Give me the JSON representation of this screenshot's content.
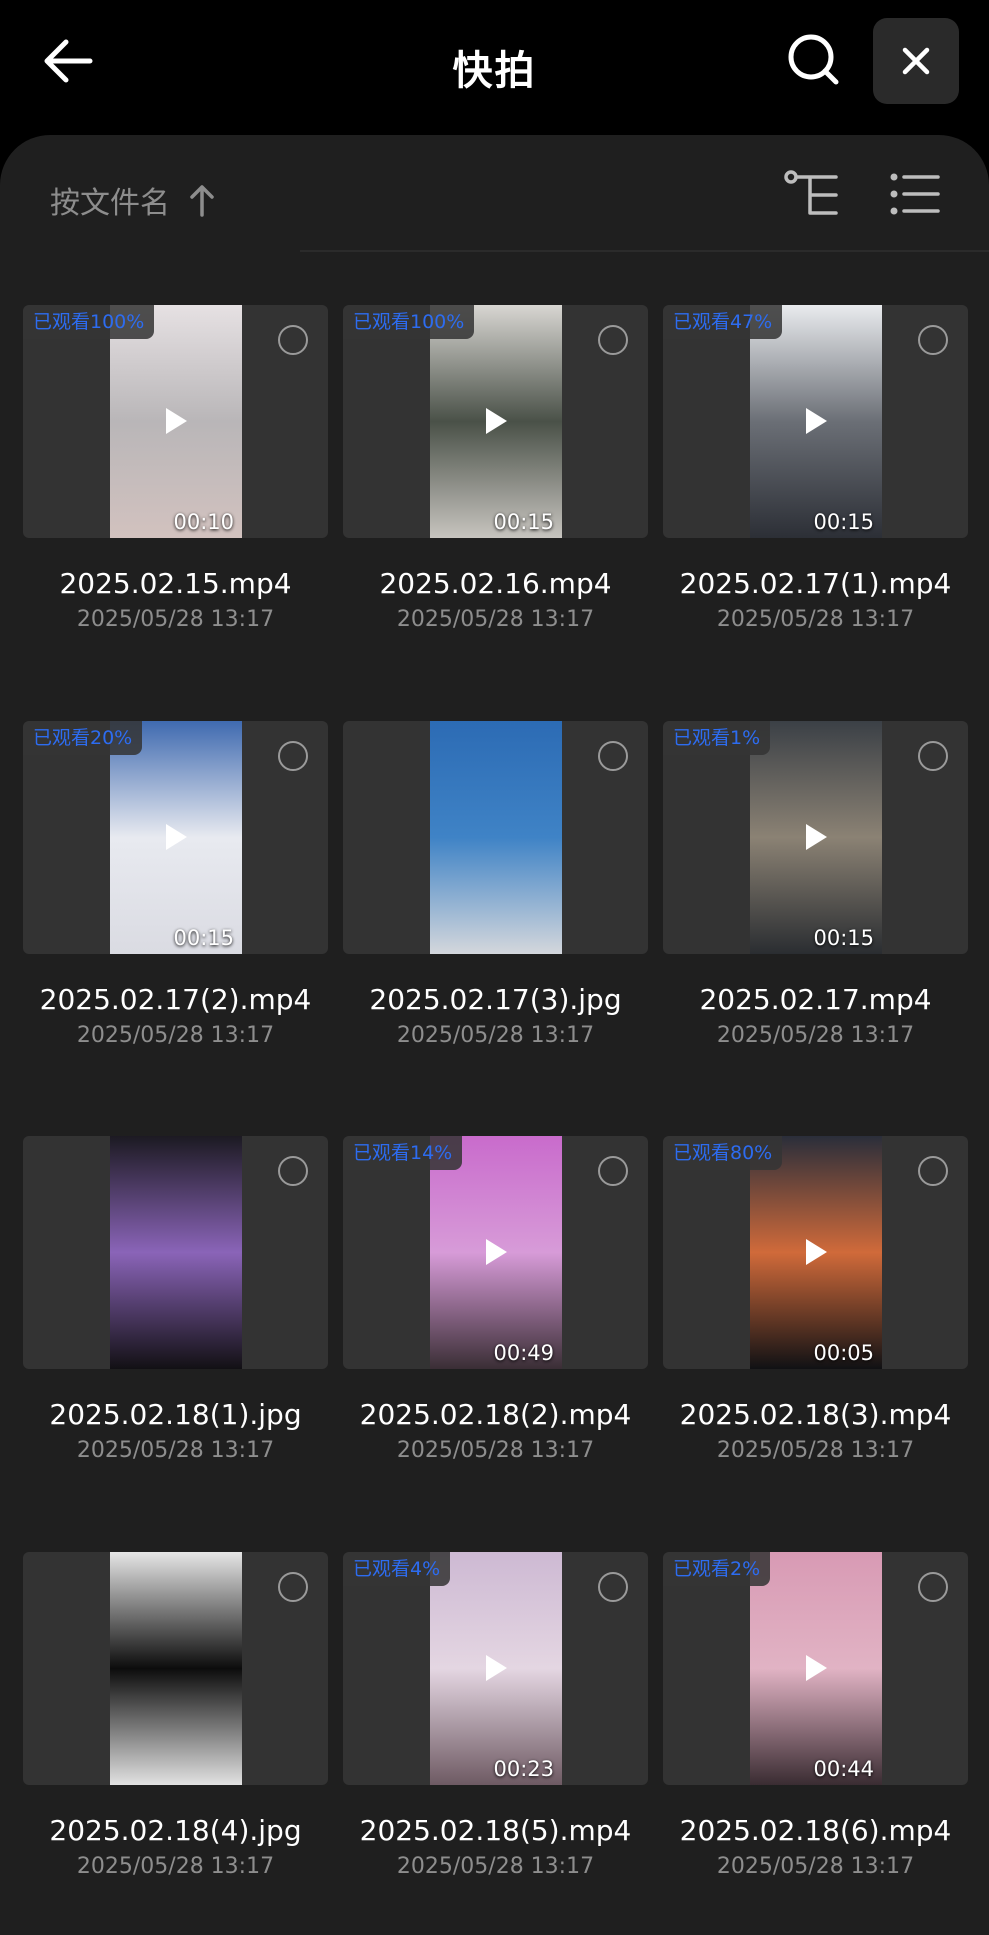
{
  "header": {
    "title": "快拍"
  },
  "sort": {
    "label": "按文件名"
  },
  "items": [
    {
      "name": "2025.02.15.mp4",
      "date": "2025/05/28 13:17",
      "watched": "已观看100%",
      "duration": "00:10",
      "video": true,
      "top": "#e6e1e3",
      "mid": "#b9b6b8",
      "bottom": "#d2c2bf",
      "has_play": true
    },
    {
      "name": "2025.02.16.mp4",
      "date": "2025/05/28 13:17",
      "watched": "已观看100%",
      "duration": "00:15",
      "video": true,
      "top": "#d8d6d2",
      "mid": "#4a5148",
      "bottom": "#c7c4bf",
      "has_play": true
    },
    {
      "name": "2025.02.17(1).mp4",
      "date": "2025/05/28 13:17",
      "watched": "已观看47%",
      "duration": "00:15",
      "video": true,
      "top": "#e9ebee",
      "mid": "#6b6f76",
      "bottom": "#2c2f36",
      "has_play": true
    },
    {
      "name": "2025.02.17(2).mp4",
      "date": "2025/05/28 13:17",
      "watched": "已观看20%",
      "duration": "00:15",
      "video": true,
      "top": "#3f6ab0",
      "mid": "#e8eaf0",
      "bottom": "#dadbe2",
      "has_play": true
    },
    {
      "name": "2025.02.17(3).jpg",
      "date": "2025/05/28 13:17",
      "watched": "",
      "duration": "",
      "video": false,
      "top": "#2c6bb4",
      "mid": "#3f83c6",
      "bottom": "#d4d7dc",
      "has_play": false
    },
    {
      "name": "2025.02.17.mp4",
      "date": "2025/05/28 13:17",
      "watched": "已观看1%",
      "duration": "00:15",
      "video": true,
      "top": "#3b4046",
      "mid": "#8b8274",
      "bottom": "#2a2d31",
      "has_play": true
    },
    {
      "name": "2025.02.18(1).jpg",
      "date": "2025/05/28 13:17",
      "watched": "",
      "duration": "",
      "video": false,
      "top": "#1c1a22",
      "mid": "#8a64b8",
      "bottom": "#121014",
      "has_play": false
    },
    {
      "name": "2025.02.18(2).mp4",
      "date": "2025/05/28 13:17",
      "watched": "已观看14%",
      "duration": "00:49",
      "video": true,
      "top": "#c96bcc",
      "mid": "#d79bd8",
      "bottom": "#3a2e35",
      "has_play": true
    },
    {
      "name": "2025.02.18(3).mp4",
      "date": "2025/05/28 13:17",
      "watched": "已观看80%",
      "duration": "00:05",
      "video": true,
      "top": "#2a2e3a",
      "mid": "#d06a3a",
      "bottom": "#101114",
      "has_play": true
    },
    {
      "name": "2025.02.18(4).jpg",
      "date": "2025/05/28 13:17",
      "watched": "",
      "duration": "",
      "video": false,
      "top": "#e6e6e6",
      "mid": "#0c0c0c",
      "bottom": "#e2e2e2",
      "has_play": false
    },
    {
      "name": "2025.02.18(5).mp4",
      "date": "2025/05/28 13:17",
      "watched": "已观看4%",
      "duration": "00:23",
      "video": true,
      "top": "#cdb9d3",
      "mid": "#e4d6e2",
      "bottom": "#6e5a63",
      "has_play": true
    },
    {
      "name": "2025.02.18(6).mp4",
      "date": "2025/05/28 13:17",
      "watched": "已观看2%",
      "duration": "00:44",
      "video": true,
      "top": "#d89ab4",
      "mid": "#e1b3c4",
      "bottom": "#3a2c32",
      "has_play": true
    }
  ]
}
